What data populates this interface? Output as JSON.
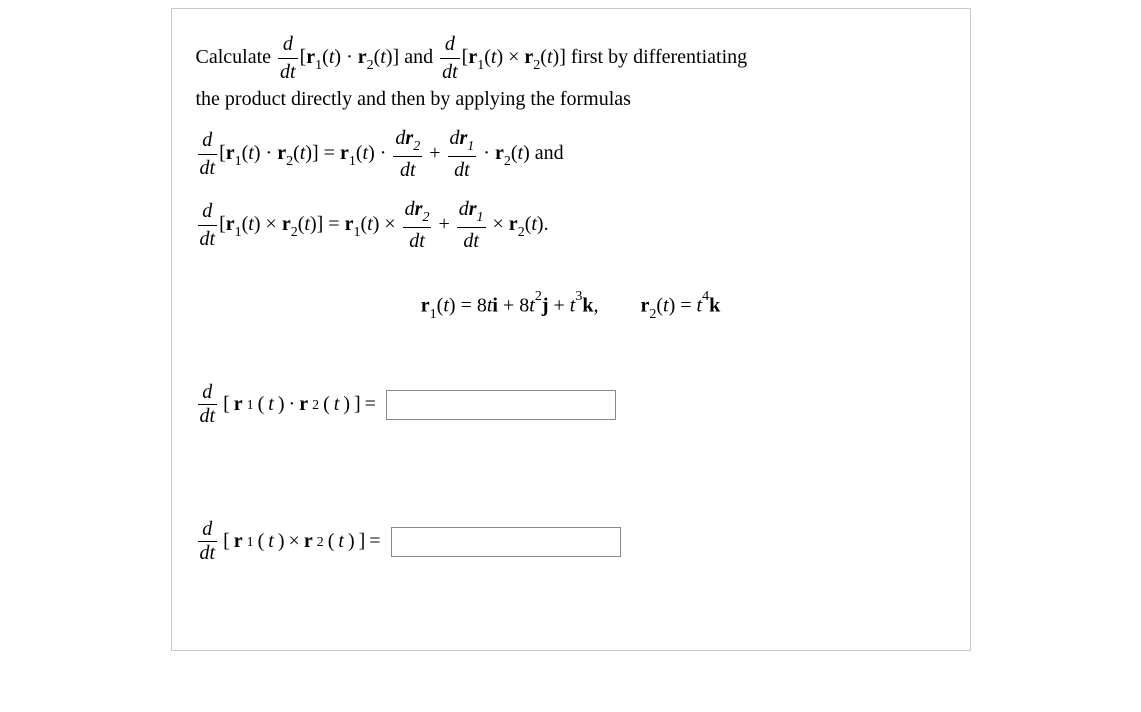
{
  "problem": {
    "intro_prefix": "Calculate ",
    "intro_mid": " and ",
    "intro_suffix": " first by differentiating",
    "intro_line2": "the product directly and then by applying the formulas",
    "and_text": " and",
    "period": ".",
    "given_comma": ",",
    "r1_def_pieces": {
      "coef_i": "8",
      "coef_j": "8",
      "j_exp": "2",
      "k_exp": "3"
    },
    "r2_def_pieces": {
      "t_exp": "4"
    }
  },
  "symbols": {
    "d": "d",
    "dt": "dt",
    "r1": "r",
    "r2": "r",
    "sub1": "1",
    "sub2": "2",
    "dr1": "d",
    "dr2": "d",
    "t": "t",
    "i": "i",
    "j": "j",
    "k": "k",
    "eq": " = ",
    "plus": " + ",
    "dot": " · ",
    "cross": " × ",
    "lbr": "[",
    "rbr": "]",
    "lpar": "(",
    "rpar": ")"
  },
  "answers": {
    "dot_value": "",
    "cross_value": ""
  }
}
